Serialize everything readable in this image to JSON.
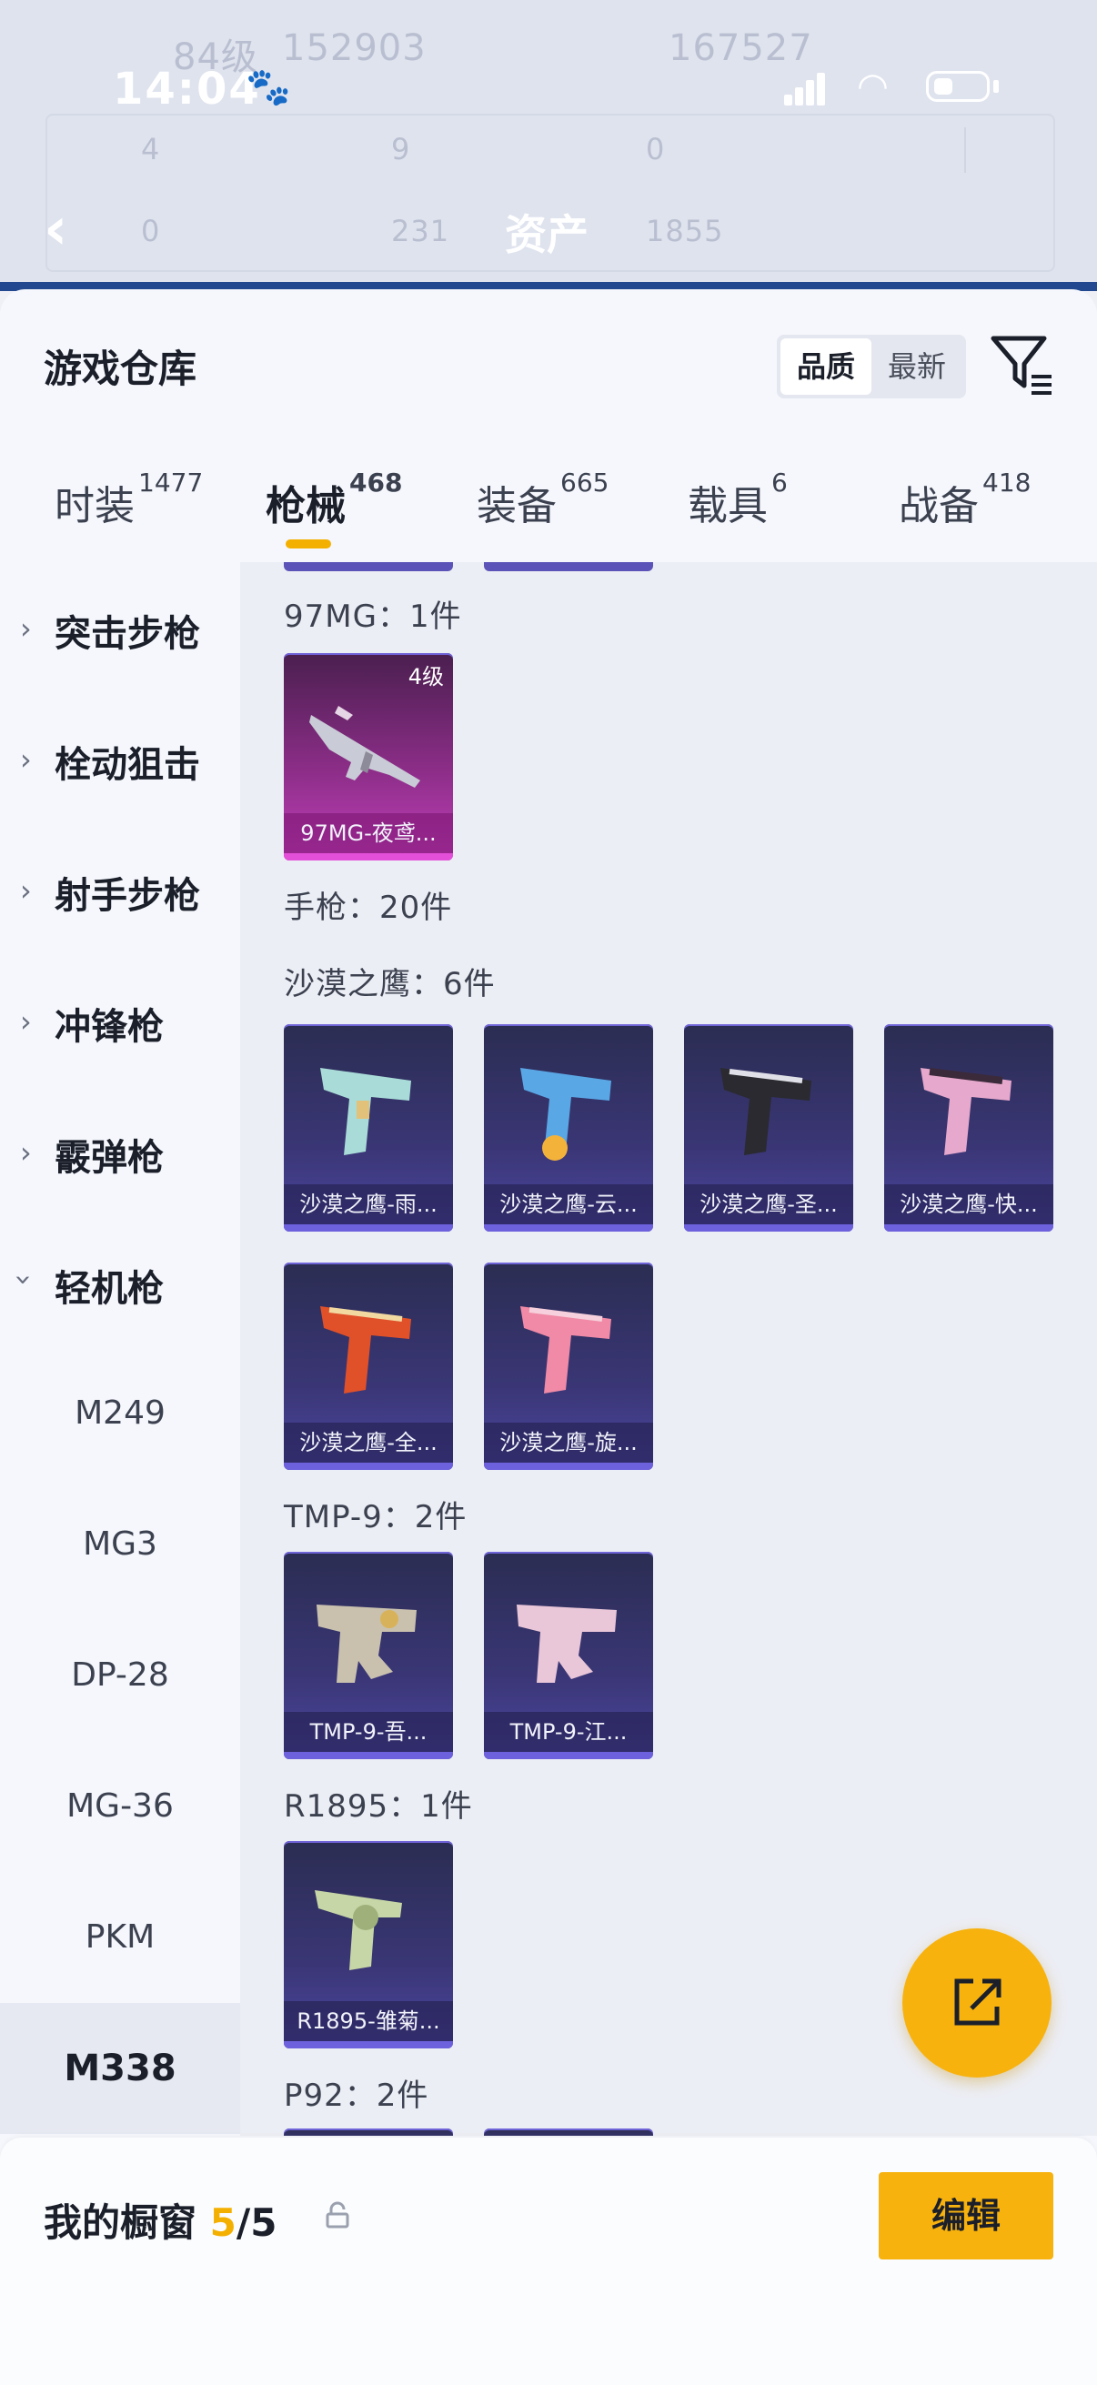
{
  "status_bar": {
    "time": "14:04",
    "paw": "🐾"
  },
  "header_bg": {
    "level": "84级",
    "views": "152903",
    "likes": "167527",
    "row1": [
      "4",
      "9",
      "0"
    ],
    "row2": [
      "0",
      "231",
      "1855"
    ],
    "title": "资产"
  },
  "warehouse": {
    "title": "游戏仓库",
    "sort": {
      "quality": "品质",
      "newest": "最新"
    }
  },
  "tabs": [
    {
      "label": "时装",
      "count": "1477"
    },
    {
      "label": "枪械",
      "count": "468"
    },
    {
      "label": "装备",
      "count": "665"
    },
    {
      "label": "载具",
      "count": "6"
    },
    {
      "label": "战备",
      "count": "418"
    }
  ],
  "sidebar": {
    "categories": [
      "突击步枪",
      "栓动狙击",
      "射手步枪",
      "冲锋枪",
      "霰弹枪",
      "轻机枪"
    ],
    "sub_items": [
      "M249",
      "MG3",
      "DP-28",
      "MG-36",
      "PKM",
      "M338"
    ]
  },
  "content": {
    "sections": {
      "mg97": "97MG：1件",
      "pistol": "手枪：20件",
      "deagle": "沙漠之鹰：6件",
      "tmp9": "TMP-9：2件",
      "r1895": "R1895：1件",
      "p92": "P92：2件"
    },
    "cards": {
      "mg97": {
        "name": "97MG-夜鸢...",
        "level": "4级"
      },
      "deagle": [
        "沙漠之鹰-雨...",
        "沙漠之鹰-云...",
        "沙漠之鹰-圣...",
        "沙漠之鹰-快...",
        "沙漠之鹰-全...",
        "沙漠之鹰-旋..."
      ],
      "tmp9": [
        "TMP-9-吾...",
        "TMP-9-江..."
      ],
      "r1895": [
        "R1895-雏菊..."
      ]
    }
  },
  "showcase": {
    "title": "我的橱窗",
    "current": "5",
    "separator": "/",
    "max": "5",
    "edit": "编辑"
  },
  "colors": {
    "accent": "#f7b20e",
    "card_purple": "#8a2d86",
    "card_blue": "#3a3676",
    "header_blue": "#22488f"
  }
}
